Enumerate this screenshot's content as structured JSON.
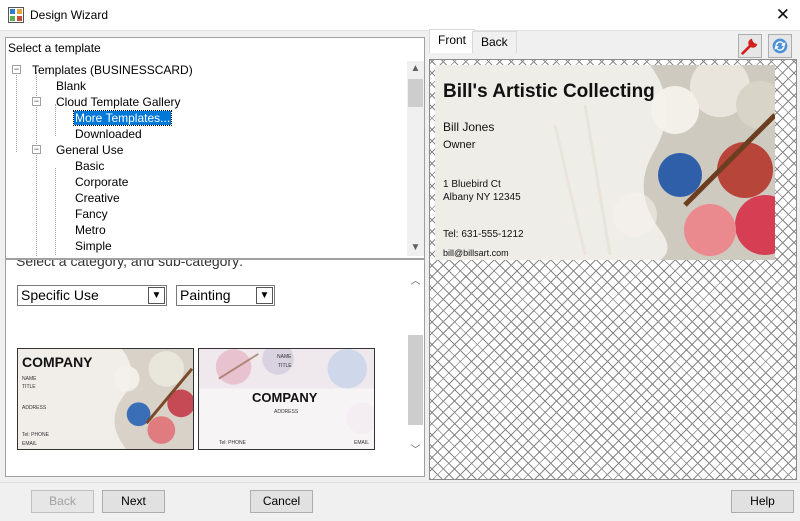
{
  "window": {
    "title": "Design Wizard"
  },
  "template_tree": {
    "label": "Select a template",
    "items": [
      {
        "label": "Templates (BUSINESSCARD)",
        "level": 0,
        "expander": "−"
      },
      {
        "label": "Blank",
        "level": 1
      },
      {
        "label": "Cloud Template Gallery",
        "level": 1,
        "expander": "−"
      },
      {
        "label": "More Templates...",
        "level": 2,
        "selected": true
      },
      {
        "label": "Downloaded",
        "level": 2
      },
      {
        "label": "General Use",
        "level": 1,
        "expander": "−"
      },
      {
        "label": "Basic",
        "level": 2
      },
      {
        "label": "Corporate",
        "level": 2
      },
      {
        "label": "Creative",
        "level": 2
      },
      {
        "label": "Fancy",
        "level": 2
      },
      {
        "label": "Metro",
        "level": 2
      },
      {
        "label": "Simple",
        "level": 2
      }
    ]
  },
  "category": {
    "prompt": "Select a category, and sub-category:",
    "category_value": "Specific Use",
    "subcategory_value": "Painting"
  },
  "thumbnails": [
    {
      "company": "COMPANY",
      "name": "NAME",
      "title": "TITLE",
      "address": "ADDRESS",
      "phone": "Tel: PHONE",
      "email": "EMAIL"
    },
    {
      "company": "COMPANY",
      "name": "NAME",
      "title": "TITLE",
      "address": "ADDRESS",
      "phone": "Tel: PHONE",
      "email": "EMAIL"
    }
  ],
  "tabs": [
    {
      "label": "Front",
      "active": true
    },
    {
      "label": "Back",
      "active": false
    }
  ],
  "card": {
    "business": "Bill's Artistic Collecting",
    "name": "Bill Jones",
    "title": "Owner",
    "address1": "1 Bluebird Ct",
    "address2": "Albany NY 12345",
    "phone": "Tel: 631-555-1212",
    "email": "bill@billsart.com"
  },
  "buttons": {
    "back": "Back",
    "next": "Next",
    "cancel": "Cancel",
    "help": "Help"
  },
  "icons": {
    "wrench": "wrench-icon",
    "refresh": "refresh-icon",
    "app": "design-wizard-icon"
  }
}
